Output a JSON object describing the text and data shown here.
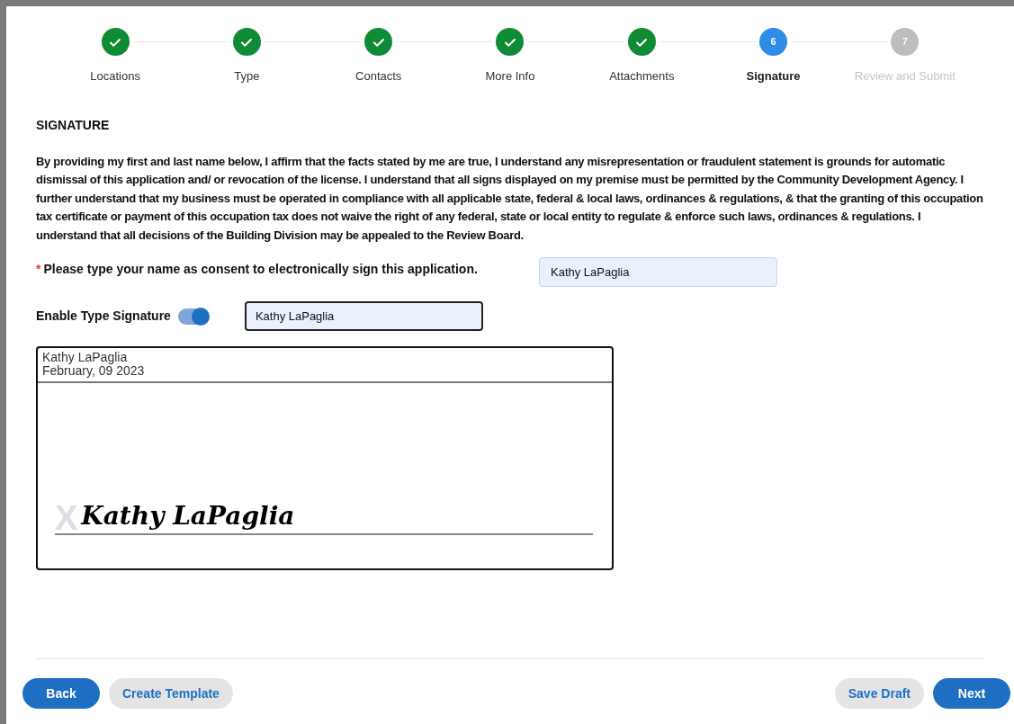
{
  "steps": [
    {
      "label": "Locations",
      "completed": true,
      "selected": false
    },
    {
      "label": "Type",
      "completed": true,
      "selected": false
    },
    {
      "label": "Contacts",
      "completed": true,
      "selected": false
    },
    {
      "label": "More Info",
      "completed": true,
      "selected": false
    },
    {
      "label": "Attachments",
      "completed": true,
      "selected": false
    },
    {
      "label": "Signature",
      "completed": false,
      "selected": true,
      "number": "6"
    },
    {
      "label": "Review and Submit",
      "completed": false,
      "selected": false,
      "number": "7"
    }
  ],
  "section_title": "SIGNATURE",
  "statement": "By providing my first and last name below, I affirm that the facts stated by me are true, I understand any misrepresentation or fraudulent statement is grounds for automatic dismissal of this application and/ or revocation of the license. I understand that all signs displayed on my premise must be permitted by the Community Development Agency. I further understand that my business must be operated in compliance with all applicable state, federal & local laws, ordinances & regulations, & that the granting of this occupation tax certificate or payment of this occupation tax does not waive the right of any federal, state or local entity to regulate & enforce such laws, ordinances & regulations. I understand that all decisions of the Building Division may be appealed to the Review Board.",
  "consent": {
    "required_mark": "*",
    "label": "Please type your name as consent to electronically sign this application.",
    "value": "Kathy LaPaglia"
  },
  "type_signature": {
    "label": "Enable Type Signature",
    "on": true,
    "value": "Kathy LaPaglia"
  },
  "signature_pad": {
    "name": "Kathy LaPaglia",
    "date": "February, 09 2023",
    "mark": "X",
    "signature": "Kathy LaPaglia"
  },
  "buttons_left": [
    {
      "label": "Back",
      "kind": "primary"
    },
    {
      "label": "Create Template",
      "kind": "secondary"
    }
  ],
  "buttons_right": [
    {
      "label": "Save Draft",
      "kind": "secondary"
    },
    {
      "label": "Next",
      "kind": "primary"
    }
  ]
}
